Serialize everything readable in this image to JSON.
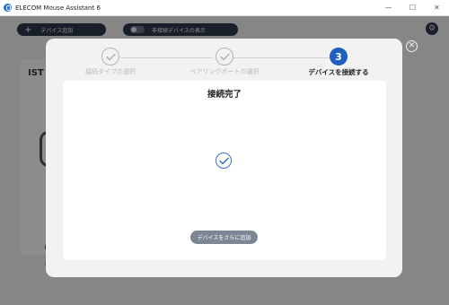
{
  "window": {
    "title": "ELECOM Mouse Assistant 6",
    "controls": {
      "minimize": "—",
      "maximize": "☐",
      "close": "✕"
    }
  },
  "background": {
    "add_device_label": "デバイス追加",
    "toggle_label": "非接続デバイスの表示",
    "card_label": "IST",
    "gear_icon": "⚙"
  },
  "dialog": {
    "close_label": "✕",
    "steps": [
      {
        "label": "接続タイプの選択",
        "state": "done"
      },
      {
        "label": "ペアリングポートの選択",
        "state": "done"
      },
      {
        "label": "デバイスを接続する",
        "number": "3",
        "state": "active"
      }
    ],
    "content_title": "接続完了",
    "add_more_button": "デバイスをさらに追加"
  },
  "colors": {
    "accent": "#1f5fbf",
    "button_gray": "#7c8694"
  }
}
